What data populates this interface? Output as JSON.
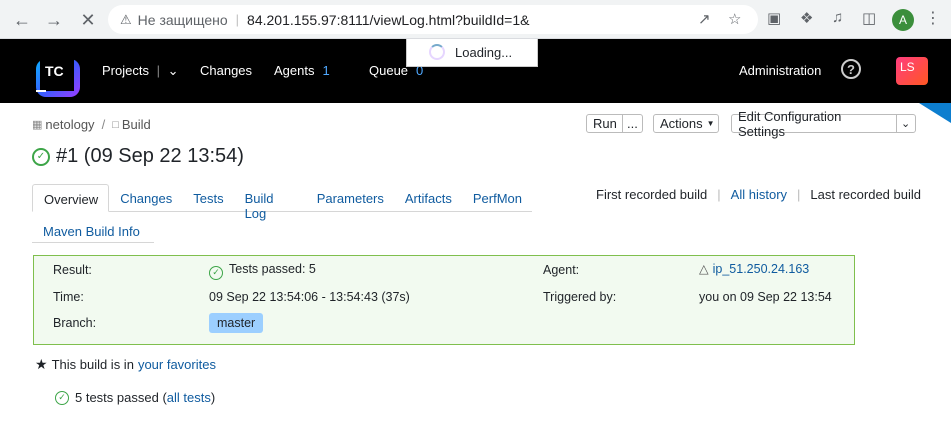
{
  "browser": {
    "security_label": "Не защищено",
    "url": "84.201.155.97:8111/viewLog.html?buildId=1&",
    "profile_initial": "A"
  },
  "header": {
    "logo_text": "TC",
    "nav": {
      "projects": "Projects",
      "changes": "Changes",
      "agents": "Agents",
      "agents_count": "1",
      "queue": "Queue",
      "queue_count": "0"
    },
    "administration": "Administration",
    "help": "?",
    "user_initials": "LS"
  },
  "loading": "Loading...",
  "breadcrumb": {
    "project": "netology",
    "build": "Build"
  },
  "actions": {
    "run": "Run",
    "more": "...",
    "actions": "Actions",
    "edit": "Edit Configuration Settings"
  },
  "title": "#1 (09 Sep 22 13:54)",
  "tabs": [
    "Overview",
    "Changes",
    "Tests",
    "Build Log",
    "Parameters",
    "Artifacts",
    "PerfMon"
  ],
  "tabs_row2": [
    "Maven Build Info"
  ],
  "history": {
    "first": "First recorded build",
    "all": "All history",
    "last": "Last recorded build"
  },
  "summary": {
    "result_label": "Result:",
    "result_value": "Tests passed: 5",
    "time_label": "Time:",
    "time_value": "09 Sep 22 13:54:06 - 13:54:43 (37s)",
    "branch_label": "Branch:",
    "branch_value": "master",
    "agent_label": "Agent:",
    "agent_value": "ip_51.250.24.163",
    "triggered_label": "Triggered by:",
    "triggered_value": "you on 09 Sep 22 13:54"
  },
  "favorites": {
    "text": "This build is in",
    "link": "your favorites"
  },
  "tests_line": {
    "text": "5 tests passed (",
    "link": "all tests",
    "close": ")"
  },
  "colors": {
    "success": "#3da548",
    "link": "#0f5b9f",
    "summary_border": "#7fbf4d",
    "branch_badge": "#9ccfff"
  }
}
